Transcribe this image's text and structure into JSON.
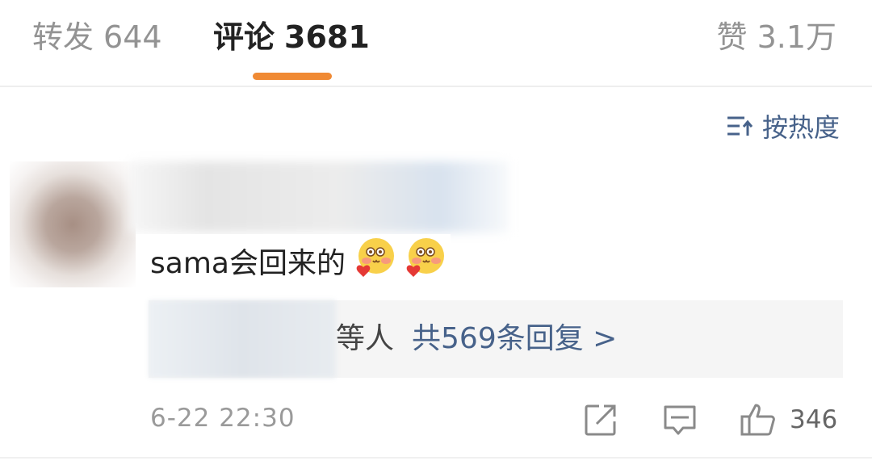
{
  "tabs": [
    {
      "label": "转发",
      "count": "644"
    },
    {
      "label": "评论",
      "count": "3681"
    },
    {
      "label": "赞",
      "count": "3.1万"
    }
  ],
  "sort": {
    "label": "按热度",
    "icon": "sort-icon"
  },
  "comment": {
    "text": "sama会回来的",
    "emojis": [
      "love-blush-emoji",
      "love-blush-emoji"
    ],
    "replies": {
      "names_suffix": "等人",
      "count_text": "共569条回复 >"
    },
    "timestamp": "6-22 22:30",
    "like_count": "346",
    "action_icons": [
      "share-icon",
      "comment-icon",
      "like-icon"
    ]
  },
  "colors": {
    "accent": "#f08a34",
    "link": "#47628a",
    "muted": "#939393"
  }
}
